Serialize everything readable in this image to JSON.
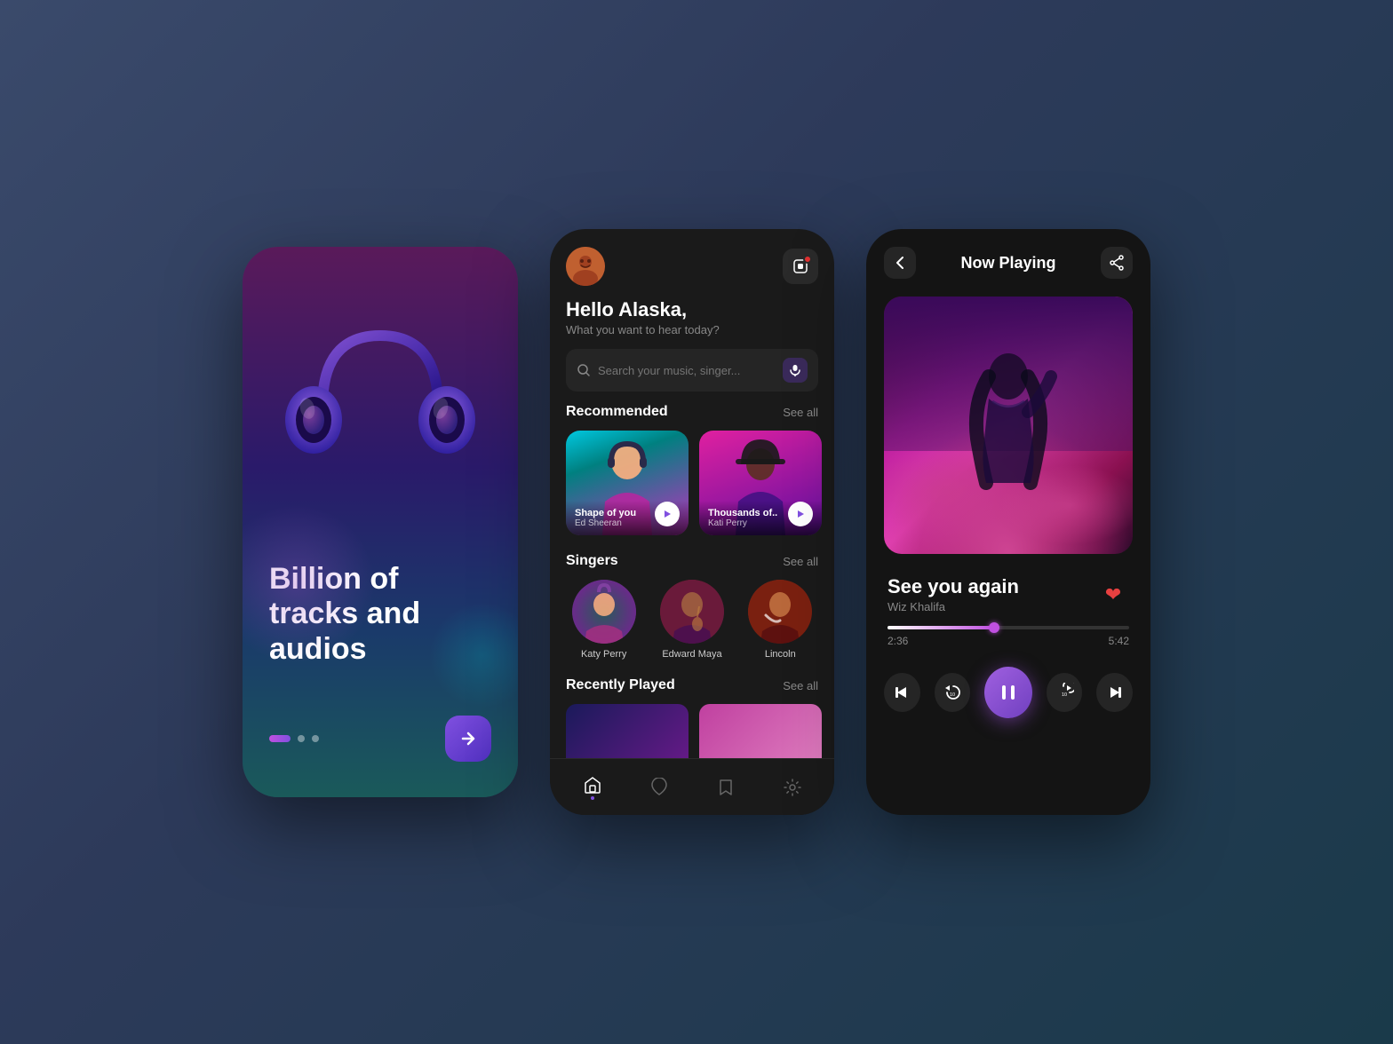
{
  "screen1": {
    "headline": "Billion of tracks and audios",
    "dots": [
      "active",
      "inactive",
      "inactive"
    ],
    "arrow_label": "→"
  },
  "screen2": {
    "greeting": "Hello Alaska,",
    "subgreeting": "What you want to hear today?",
    "search_placeholder": "Search your music, singer...",
    "sections": {
      "recommended_label": "Recommended",
      "recommended_see_all": "See all",
      "singers_label": "Singers",
      "singers_see_all": "See all",
      "recently_label": "Recently Played",
      "recently_see_all": "See all"
    },
    "recommended": [
      {
        "title": "Shape of you",
        "artist": "Ed Sheeran"
      },
      {
        "title": "Thousands of..",
        "artist": "Kati Perry"
      }
    ],
    "singers": [
      {
        "name": "Katy Perry"
      },
      {
        "name": "Edward Maya"
      },
      {
        "name": "Lincoln"
      }
    ],
    "nav": [
      {
        "icon": "🏠",
        "label": "home",
        "active": true
      },
      {
        "icon": "♡",
        "label": "favorites",
        "active": false
      },
      {
        "icon": "🔖",
        "label": "library",
        "active": false
      },
      {
        "icon": "⚙",
        "label": "settings",
        "active": false
      }
    ]
  },
  "screen3": {
    "header_title": "Now Playing",
    "back_icon": "‹",
    "share_icon": "share",
    "track_name": "See you again",
    "track_artist": "Wiz Khalifa",
    "current_time": "2:36",
    "total_time": "5:42",
    "progress_percent": 44,
    "controls": {
      "prev": "⏮",
      "rewind": "↺10",
      "play_pause": "⏸",
      "forward": "↻10",
      "next": "⏭"
    }
  }
}
